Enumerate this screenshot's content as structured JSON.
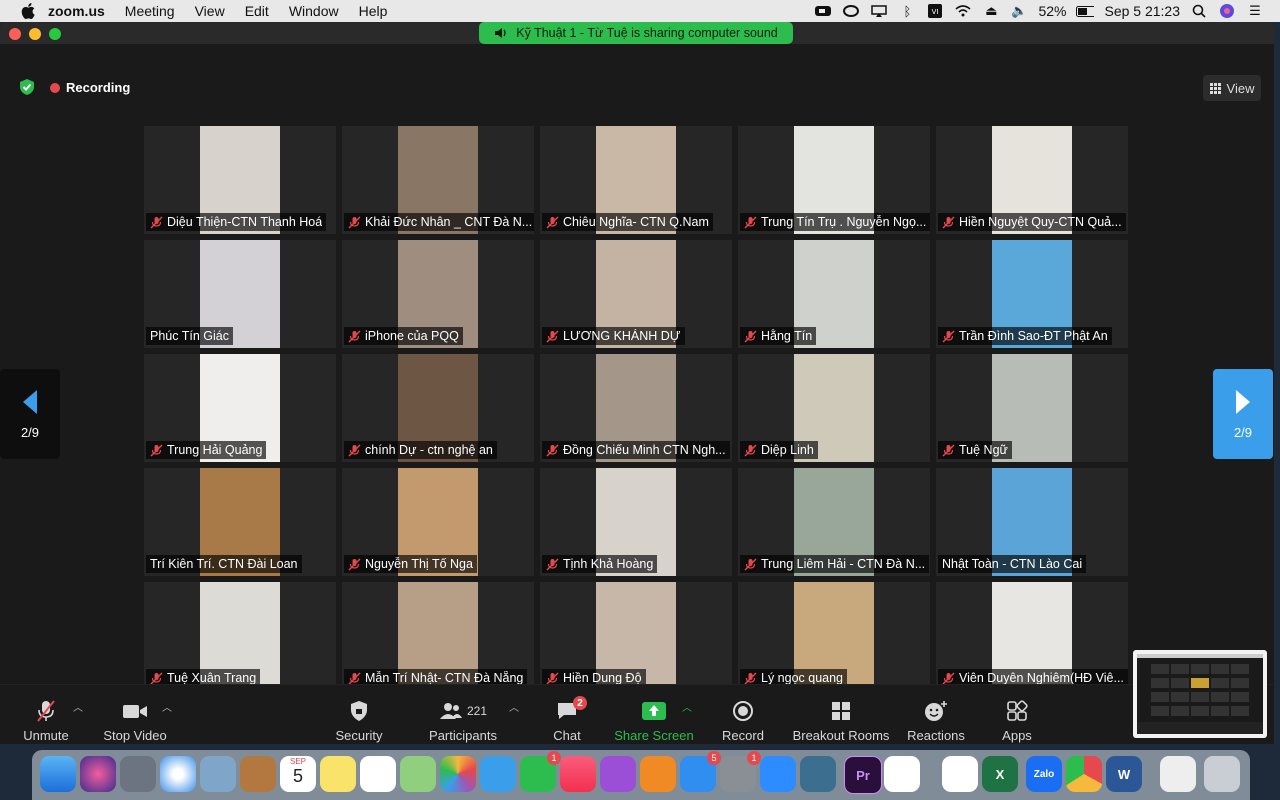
{
  "menubar": {
    "app": "zoom.us",
    "items": [
      "Meeting",
      "View",
      "Edit",
      "Window",
      "Help"
    ],
    "battery": "52%",
    "clock": "Sep 5  21:23"
  },
  "banner": {
    "text": "Kỹ Thuật 1  - Từ Tuệ is sharing computer sound"
  },
  "meeting": {
    "recording_label": "Recording",
    "view_label": "View",
    "page_prev": "2/9",
    "page_next": "2/9"
  },
  "participants": [
    {
      "name": "Diệu Thiện-CTN Thanh Hoá",
      "muted": true,
      "bg": "#d8d2cc"
    },
    {
      "name": "Khải Đức Nhân _ CNT Đà N...",
      "muted": true,
      "bg": "#8a7664"
    },
    {
      "name": "Chiêu Nghĩa- CTN Q.Nam",
      "muted": true,
      "bg": "#c9b8a6"
    },
    {
      "name": "Trung Tín Trụ . Nguyễn Ngọ...",
      "muted": true,
      "bg": "#e3e3df"
    },
    {
      "name": "Hiền Nguyệt Quy-CTN Quả...",
      "muted": true,
      "bg": "#e6e2dc"
    },
    {
      "name": "Phúc Tín Giác",
      "muted": false,
      "bg": "#d4d1d6"
    },
    {
      "name": "iPhone của PQQ",
      "muted": true,
      "bg": "#9f8d80"
    },
    {
      "name": "LƯƠNG KHÁNH DỰ",
      "muted": true,
      "bg": "#c4b3a2"
    },
    {
      "name": "Hằng Tín",
      "muted": true,
      "bg": "#cfd2cc"
    },
    {
      "name": "Trần Đình Sao-ĐT Phật  An",
      "muted": true,
      "bg": "#5aa7d9"
    },
    {
      "name": "Trung Hải Quảng",
      "muted": true,
      "bg": "#efeeec"
    },
    {
      "name": "chính Dự - ctn nghệ an",
      "muted": true,
      "bg": "#6e5644"
    },
    {
      "name": "Đồng Chiếu Minh CTN Ngh...",
      "muted": true,
      "bg": "#a4978a"
    },
    {
      "name": "Diệp Linh",
      "muted": true,
      "bg": "#cfc9b9"
    },
    {
      "name": "Tuệ Ngữ",
      "muted": true,
      "bg": "#b8bcb6"
    },
    {
      "name": "Trí Kiên Trí. CTN Đài Loan",
      "muted": false,
      "bg": "#a77a48"
    },
    {
      "name": "Nguyễn Thị Tố Nga",
      "muted": true,
      "bg": "#c39a6e"
    },
    {
      "name": "Tịnh Khả Hoàng",
      "muted": true,
      "bg": "#d7d2cc"
    },
    {
      "name": "Trung Liêm Hải - CTN Đà N...",
      "muted": true,
      "bg": "#99a79a"
    },
    {
      "name": "Nhật Toàn - CTN Lào Cai",
      "muted": false,
      "bg": "#5ba4d8"
    },
    {
      "name": "Tuệ Xuân Trang",
      "muted": true,
      "bg": "#dcdbd6"
    },
    {
      "name": "Mẫn Trí Nhật- CTN Đà Nẵng",
      "muted": true,
      "bg": "#b79e86"
    },
    {
      "name": "Hiền Dung Độ",
      "muted": true,
      "bg": "#c7b7a8"
    },
    {
      "name": "Lý ngọc quang",
      "muted": true,
      "bg": "#c8a97d"
    },
    {
      "name": "Viên Duyên Nghiêm(HĐ Viê...",
      "muted": true,
      "bg": "#e8e6e3"
    }
  ],
  "toolbar": {
    "unmute": "Unmute",
    "stop_video": "Stop Video",
    "security": "Security",
    "participants": "Participants",
    "participants_count": "221",
    "chat": "Chat",
    "chat_badge": "2",
    "share_screen": "Share Screen",
    "record": "Record",
    "breakout": "Breakout Rooms",
    "reactions": "Reactions",
    "apps": "Apps"
  },
  "dock": {
    "calendar_month": "SEP",
    "calendar_day": "5",
    "messages_badge": "1",
    "appstore_badge": "5",
    "prefs_badge": "1",
    "premiere_label": "Pr",
    "excel_label": "X",
    "zalo_label": "Zalo",
    "word_label": "W"
  },
  "colors": {
    "accent_green": "#2dbd4e",
    "accent_blue": "#3a9eea",
    "mute_red": "#e5484d"
  }
}
